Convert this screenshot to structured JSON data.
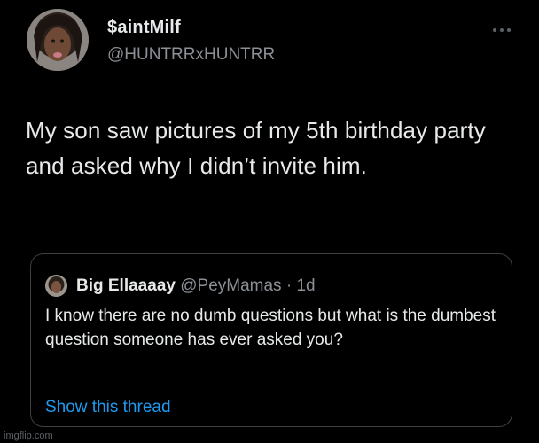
{
  "tweet": {
    "author": {
      "display_name": "$aintMilf",
      "handle": "@HUNTRRxHUNTRR",
      "avatar_icon": "profile-photo-avatar"
    },
    "more_icon": "more-horizontal-icon",
    "text": "My son saw pictures of my 5th birthday party and asked why I didn’t invite him."
  },
  "quote": {
    "author": {
      "display_name": "Big Ellaaaay",
      "handle": "@PeyMamas",
      "separator": "·",
      "time": "1d",
      "avatar_icon": "profile-photo-avatar"
    },
    "text": "I know there are no dumb questions but what is the dumbest question someone has ever asked you?",
    "show_thread_label": "Show this thread"
  },
  "watermark": "imgflip.com",
  "colors": {
    "background": "#000000",
    "primary_text": "#e7e9ea",
    "secondary_text": "#8b9096",
    "link": "#1d9bf0",
    "border": "#3c4043"
  }
}
